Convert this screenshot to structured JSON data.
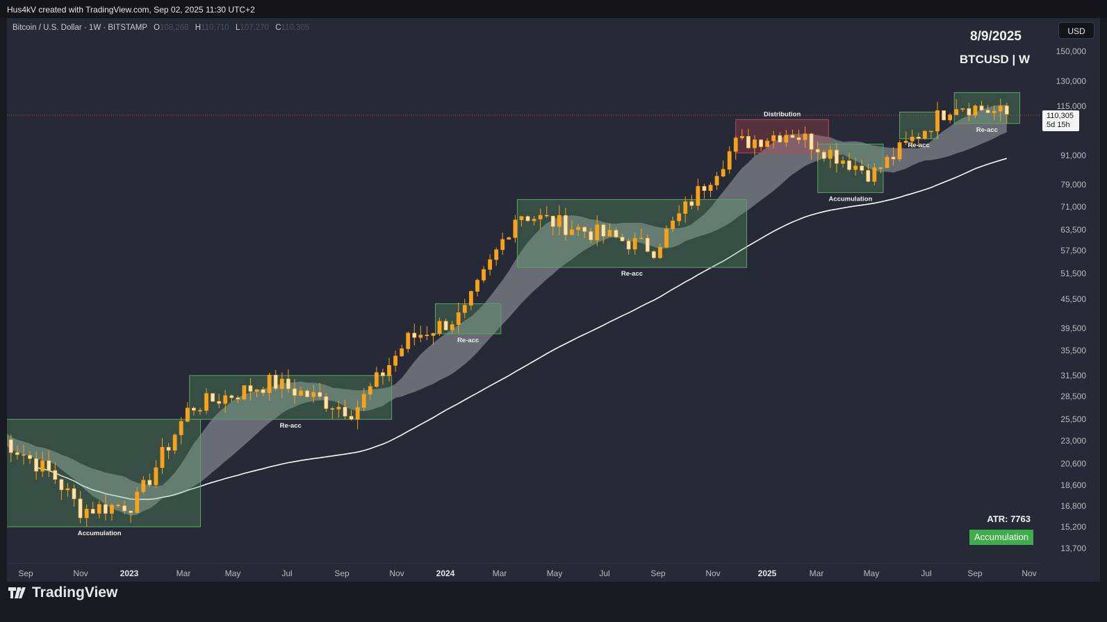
{
  "topbar": {
    "credit": "Hus4kV created with TradingView.com, Sep 02, 2025 11:30 UTC+2"
  },
  "symbol": {
    "name": "Bitcoin / U.S. Dollar · 1W · BITSTAMP",
    "open_label": "O",
    "open": "108,268",
    "high_label": "H",
    "high": "110,710",
    "low_label": "L",
    "low": "107,270",
    "close_label": "C",
    "close": "110,305"
  },
  "notes": {
    "date": "8/9/2025",
    "pair": "BTCUSD | W",
    "atr": "ATR: 7763",
    "phase_badge": "Accumulation"
  },
  "currency_badge": "USD",
  "last_price": {
    "price": "110,305",
    "countdown": "5d 15h"
  },
  "brand": {
    "name": "TradingView"
  },
  "colors": {
    "background": "#262a36",
    "candle": "#f7a21b",
    "candle_wick": "#f7a21b",
    "ma_slow": "#ffffff",
    "ribbon": "#b8bcc4",
    "range_box": "#5fa36a",
    "distribution_box": "#c0464f",
    "badge": "#3fae4a"
  },
  "chart_data": {
    "type": "candlestick",
    "scale": "log",
    "ylim": [
      13700,
      150000
    ],
    "y_ticks": [
      "150,000",
      "130,000",
      "115,000",
      "91,000",
      "79,000",
      "71,000",
      "63,500",
      "57,500",
      "51,500",
      "45,500",
      "39,500",
      "35,500",
      "31,500",
      "28,500",
      "25,500",
      "23,000",
      "20,600",
      "18,600",
      "16,800",
      "15,200",
      "13,700"
    ],
    "x_ticks": [
      {
        "label": "Sep",
        "year": false
      },
      {
        "label": "Nov",
        "year": false
      },
      {
        "label": "2023",
        "year": true
      },
      {
        "label": "Mar",
        "year": false
      },
      {
        "label": "May",
        "year": false
      },
      {
        "label": "Jul",
        "year": false
      },
      {
        "label": "Sep",
        "year": false
      },
      {
        "label": "Nov",
        "year": false
      },
      {
        "label": "2024",
        "year": true
      },
      {
        "label": "Mar",
        "year": false
      },
      {
        "label": "May",
        "year": false
      },
      {
        "label": "Jul",
        "year": false
      },
      {
        "label": "Sep",
        "year": false
      },
      {
        "label": "Nov",
        "year": false
      },
      {
        "label": "2025",
        "year": true
      },
      {
        "label": "Mar",
        "year": false
      },
      {
        "label": "May",
        "year": false
      },
      {
        "label": "Jul",
        "year": false
      },
      {
        "label": "Sep",
        "year": false
      },
      {
        "label": "Nov",
        "year": false
      }
    ],
    "key_closes": [
      {
        "date": "2022-08",
        "close": 23500
      },
      {
        "date": "2022-10",
        "close": 19500
      },
      {
        "date": "2022-11",
        "close": 16500
      },
      {
        "date": "2023-01",
        "close": 17000
      },
      {
        "date": "2023-03",
        "close": 27000
      },
      {
        "date": "2023-06",
        "close": 30500
      },
      {
        "date": "2023-09",
        "close": 26500
      },
      {
        "date": "2023-11",
        "close": 37500
      },
      {
        "date": "2024-01",
        "close": 42000
      },
      {
        "date": "2024-03",
        "close": 69000
      },
      {
        "date": "2024-08",
        "close": 58000
      },
      {
        "date": "2024-11",
        "close": 96000
      },
      {
        "date": "2025-01",
        "close": 102000
      },
      {
        "date": "2025-04",
        "close": 83000
      },
      {
        "date": "2025-07",
        "close": 117000
      },
      {
        "date": "2025-09",
        "close": 110305
      }
    ],
    "zones": [
      {
        "label": "Accumulation",
        "start": "2022-08",
        "end": "2023-03",
        "low": 15200,
        "high": 25500,
        "type": "range"
      },
      {
        "label": "Re-acc",
        "start": "2023-03",
        "end": "2023-10",
        "low": 25500,
        "high": 31500,
        "type": "range"
      },
      {
        "label": "Re-acc",
        "start": "2023-12",
        "end": "2024-02",
        "low": 38500,
        "high": 44500,
        "type": "range"
      },
      {
        "label": "Re-acc",
        "start": "2024-03",
        "end": "2024-11",
        "low": 53000,
        "high": 73500,
        "type": "range"
      },
      {
        "label": "Distribution",
        "start": "2024-11",
        "end": "2025-02",
        "low": 92000,
        "high": 108000,
        "type": "distribution"
      },
      {
        "label": "Accumulation",
        "start": "2025-02",
        "end": "2025-04",
        "low": 76000,
        "high": 96000,
        "type": "range"
      },
      {
        "label": "Re-acc",
        "start": "2025-05",
        "end": "2025-06",
        "low": 98500,
        "high": 112000,
        "type": "range"
      },
      {
        "label": "Re-acc",
        "start": "2025-07",
        "end": "2025-09",
        "low": 106000,
        "high": 123000,
        "type": "range"
      }
    ]
  }
}
